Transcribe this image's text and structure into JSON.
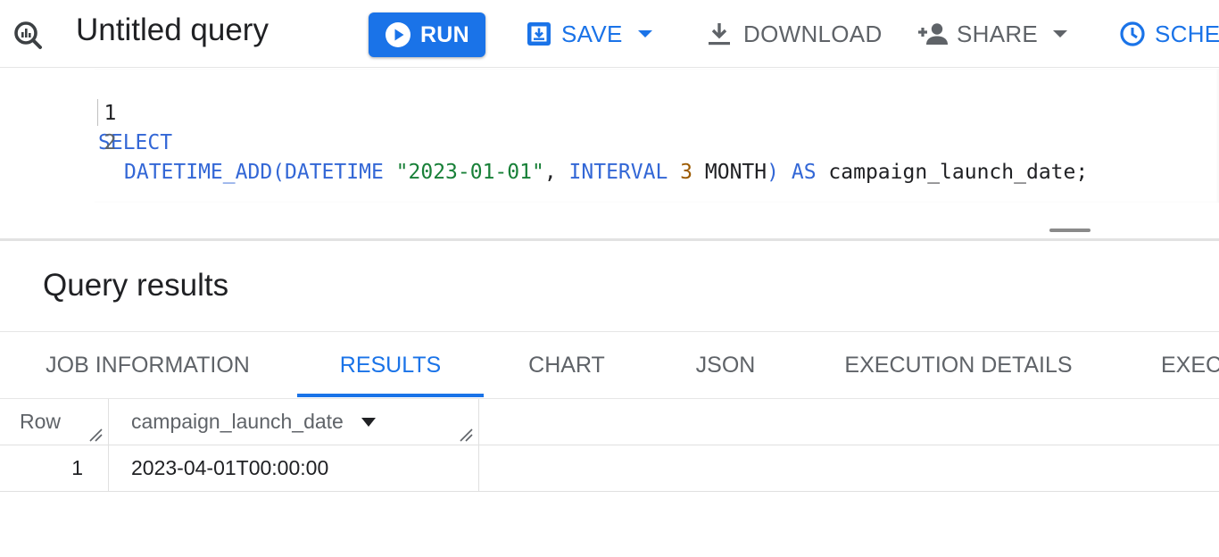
{
  "toolbar": {
    "title": "Untitled query",
    "run_label": "RUN",
    "save_label": "SAVE",
    "download_label": "DOWNLOAD",
    "share_label": "SHARE",
    "schedule_label": "SCHEDULE"
  },
  "editor": {
    "lines": [
      {
        "number": "1",
        "tokens": {
          "kw1": "SELECT"
        }
      },
      {
        "number": "2",
        "tokens": {
          "fn": "DATETIME_ADD(",
          "kw_datetime": "DATETIME",
          "sp1": " ",
          "str_date": "\"2023-01-01\"",
          "comma": ", ",
          "kw_interval": "INTERVAL",
          "sp2": " ",
          "num": "3",
          "sp3": " ",
          "month": "MONTH",
          "close": ")",
          "sp4": " ",
          "kw_as": "AS",
          "sp5": " ",
          "alias": "campaign_launch_date;"
        }
      }
    ]
  },
  "results": {
    "title": "Query results",
    "tabs": [
      "JOB INFORMATION",
      "RESULTS",
      "CHART",
      "JSON",
      "EXECUTION DETAILS",
      "EXECUTION GRAPH"
    ],
    "active_tab": "RESULTS",
    "columns": [
      "Row",
      "campaign_launch_date"
    ],
    "rows": [
      {
        "row": "1",
        "campaign_launch_date": "2023-04-01T00:00:00"
      }
    ]
  },
  "colors": {
    "accent": "#1a73e8",
    "keyword": "#3367d6",
    "string": "#188038",
    "number": "#9c5a00",
    "text": "#202124",
    "muted": "#5f6368"
  }
}
